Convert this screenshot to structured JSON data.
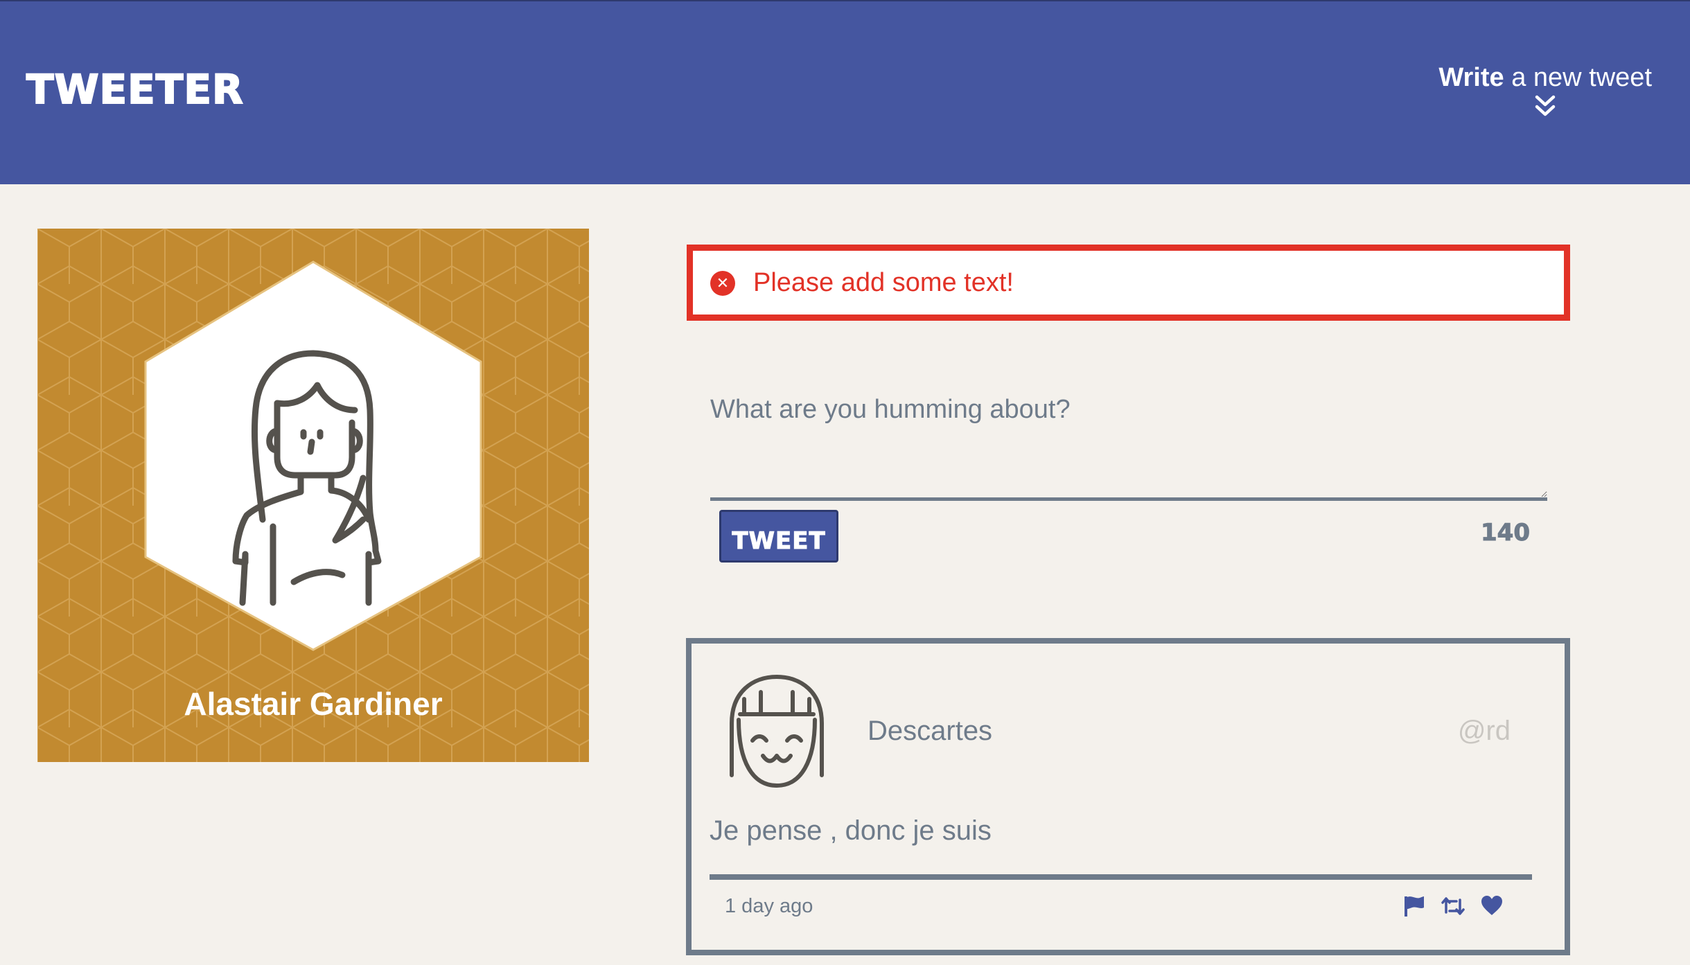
{
  "nav": {
    "brand": "TWEETER",
    "compose_toggle_bold": "Write",
    "compose_toggle_rest": " a new tweet",
    "chevron_icon": "double-chevron-down-icon"
  },
  "profile": {
    "name": "Alastair Gardiner",
    "background_color": "#c28a30",
    "avatar_icon": "female-user-avatar-icon"
  },
  "error": {
    "message": "Please add some text!",
    "icon": "error-circle-x-icon",
    "color": "#e23227"
  },
  "compose": {
    "placeholder": "What are you humming about?",
    "value": "",
    "button_label": "TWEET",
    "counter": "140"
  },
  "tweets": [
    {
      "author_name": "Descartes",
      "handle": "@rd",
      "content": "Je pense , donc je suis",
      "timestamp": "1 day ago",
      "avatar_icon": "smiling-user-avatar-icon",
      "actions": [
        "flag-icon",
        "retweet-icon",
        "heart-icon"
      ]
    }
  ],
  "colors": {
    "brand": "#4556a0",
    "page_background": "#f4f1ec",
    "muted": "#6e7b8a"
  }
}
